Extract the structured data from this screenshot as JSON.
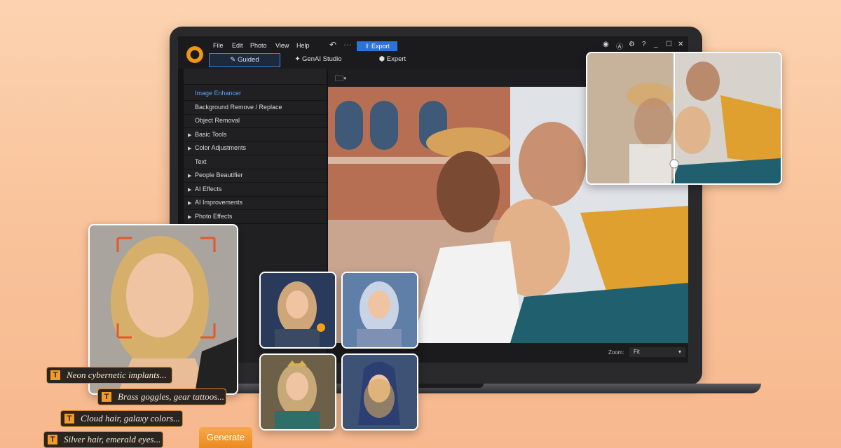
{
  "menu": [
    "File",
    "Edit",
    "Photo",
    "View",
    "Help"
  ],
  "toolbar": {
    "export_label": "Export"
  },
  "modes": [
    "Guided",
    "GenAI Studio",
    "Expert"
  ],
  "sidebar": {
    "items": [
      {
        "label": "Image Enhancer",
        "expandable": false,
        "active": true
      },
      {
        "label": "Background Remove / Replace",
        "expandable": false
      },
      {
        "label": "Object Removal",
        "expandable": false
      },
      {
        "label": "Basic Tools",
        "expandable": true
      },
      {
        "label": "Color Adjustments",
        "expandable": true
      },
      {
        "label": "Text",
        "expandable": false
      },
      {
        "label": "People Beautifier",
        "expandable": true
      },
      {
        "label": "AI Effects",
        "expandable": true
      },
      {
        "label": "AI Improvements",
        "expandable": true
      },
      {
        "label": "Photo Effects",
        "expandable": true
      }
    ]
  },
  "statusbar": {
    "zoom_label": "Zoom:",
    "zoom_value": "Fit"
  },
  "prompts": [
    "Neon cybernetic implants...",
    "Brass goggles, gear tattoos...",
    "Cloud hair, galaxy colors...",
    "Silver hair, emerald eyes..."
  ],
  "generate_label": "Generate",
  "colors": {
    "accent": "#2d72d8",
    "orange": "#ea8a22",
    "background": "#fcd3b0"
  }
}
